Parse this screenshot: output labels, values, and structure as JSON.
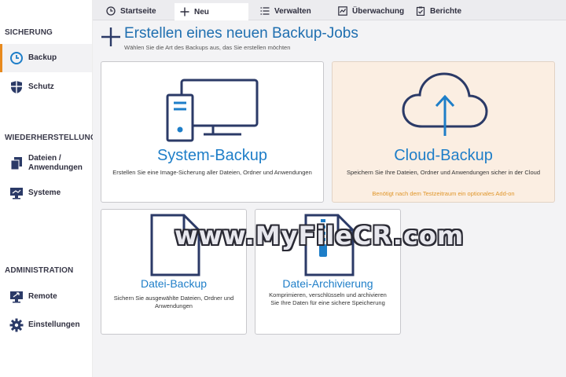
{
  "sidebar": {
    "sections": [
      {
        "title": "SICHERUNG"
      },
      {
        "title": "WIEDERHERSTELLUNG"
      },
      {
        "title": "ADMINISTRATION"
      }
    ],
    "items": [
      {
        "label": "Backup",
        "icon": "clock-icon"
      },
      {
        "label": "Schutz",
        "icon": "shield-icon"
      },
      {
        "label": "Dateien /\nAnwendungen",
        "label_line1": "Dateien /",
        "label_line2": "Anwendungen",
        "icon": "files-icon"
      },
      {
        "label": "Systeme",
        "icon": "monitor-icon"
      },
      {
        "label": "Remote",
        "icon": "remote-monitor-icon"
      },
      {
        "label": "Einstellungen",
        "icon": "gear-icon"
      }
    ]
  },
  "tabs": [
    {
      "label": "Startseite",
      "icon": "clock-icon"
    },
    {
      "label": "Neu",
      "icon": "plus-icon"
    },
    {
      "label": "Verwalten",
      "icon": "list-icon"
    },
    {
      "label": "Überwachung",
      "icon": "chart-icon"
    },
    {
      "label": "Berichte",
      "icon": "checklist-icon"
    }
  ],
  "main": {
    "title": "Erstellen eines neuen Backup-Jobs",
    "subtitle": "Wählen Sie die Art des Backups aus, das Sie erstellen möchten",
    "cards": {
      "system": {
        "title": "System-Backup",
        "desc": "Erstellen Sie eine Image-Sicherung aller Dateien, Ordner und Anwendungen"
      },
      "cloud": {
        "title": "Cloud-Backup",
        "desc": "Speichern Sie Ihre Dateien, Ordner und Anwendungen sicher in der Cloud",
        "note": "Benötigt nach dem Testzeitraum ein optionales Add-on"
      },
      "file": {
        "title": "Datei-Backup",
        "desc": "Sichern Sie ausgewählte Dateien, Ordner und Anwendungen"
      },
      "archive": {
        "title": "Datei-Archivierung",
        "desc": "Komprimieren, verschlüsseln und archivieren Sie Ihre Daten für eine sichere Speicherung"
      }
    }
  },
  "watermark": "www.MyFileCR.com",
  "colors": {
    "accent": "#1e7ec8",
    "icon_dark": "#2b3a67",
    "active_marker": "#e88a1e",
    "cloud_card_bg": "#fbeee2",
    "note": "#e0962a"
  }
}
